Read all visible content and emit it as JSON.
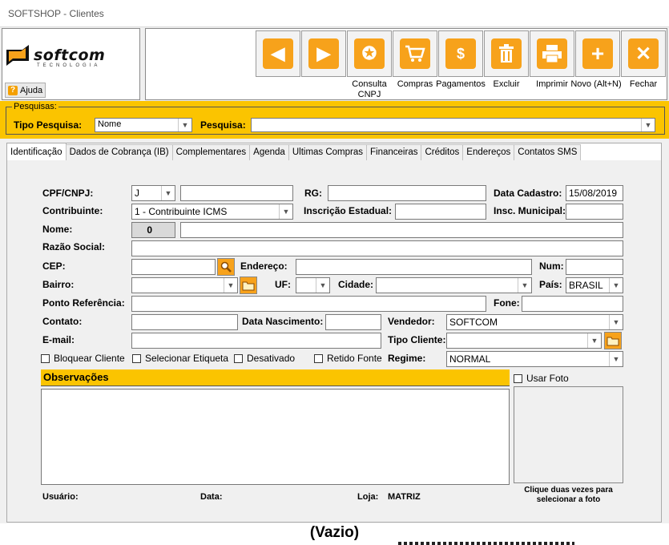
{
  "window": {
    "title": "SOFTSHOP - Clientes"
  },
  "logo": {
    "brand": "softcom",
    "tagline": "TECNOLOGIA"
  },
  "help_label": "Ajuda",
  "toolbar": {
    "nav_prev_icon": "arrow-left-icon",
    "nav_next_icon": "arrow-right-icon",
    "buttons": [
      {
        "label": "Consulta CNPJ",
        "icon": "seal-icon"
      },
      {
        "label": "Compras",
        "icon": "cart-icon"
      },
      {
        "label": "Pagamentos",
        "icon": "money-icon"
      },
      {
        "label": "Excluir",
        "icon": "trash-icon"
      },
      {
        "label": "Imprimir",
        "icon": "printer-icon"
      },
      {
        "label": "Novo (Alt+N)",
        "icon": "plus-icon"
      },
      {
        "label": "Fechar",
        "icon": "close-icon"
      }
    ],
    "accent_color": "#f7a21b"
  },
  "search": {
    "legend": "Pesquisas:",
    "type_label": "Tipo Pesquisa:",
    "type_value": "Nome",
    "query_label": "Pesquisa:",
    "query_value": ""
  },
  "tabs": [
    "Identificação",
    "Dados de Cobrança (IB)",
    "Complementares",
    "Agenda",
    "Ultimas Compras",
    "Financeiras",
    "Créditos",
    "Endereços",
    "Contatos SMS"
  ],
  "form": {
    "cpf_label": "CPF/CNPJ:",
    "cpf_type": "J",
    "cpf_value": "",
    "rg_label": "RG:",
    "rg_value": "",
    "data_cadastro_label": "Data Cadastro:",
    "data_cadastro": "15/08/2019",
    "contribuinte_label": "Contribuinte:",
    "contribuinte_value": "1 - Contribuinte ICMS",
    "ie_label": "Inscrição Estadual:",
    "ie_value": "",
    "im_label": "Insc. Municipal:",
    "im_value": "",
    "nome_label": "Nome:",
    "nome_code": "0",
    "nome_value": "",
    "razao_label": "Razão Social:",
    "razao_value": "",
    "cep_label": "CEP:",
    "cep_value": "",
    "endereco_label": "Endereço:",
    "endereco_value": "",
    "num_label": "Num:",
    "num_value": "",
    "bairro_label": "Bairro:",
    "bairro_value": "",
    "uf_label": "UF:",
    "uf_value": "",
    "cidade_label": "Cidade:",
    "cidade_value": "",
    "pais_label": "País:",
    "pais_value": "BRASIL",
    "ponto_label": "Ponto Referência:",
    "ponto_value": "",
    "fone_label": "Fone:",
    "fone_value": "",
    "contato_label": "Contato:",
    "contato_value": "",
    "nasc_label": "Data Nascimento:",
    "nasc_value": "",
    "vendedor_label": "Vendedor:",
    "vendedor_value": "SOFTCOM",
    "email_label": "E-mail:",
    "email_value": "",
    "tipo_cliente_label": "Tipo Cliente:",
    "tipo_cliente_value": "",
    "chk_bloquear": "Bloquear Cliente",
    "chk_etiqueta": "Selecionar Etiqueta",
    "chk_desativado": "Desativado",
    "chk_retido": "Retido Fonte",
    "regime_label": "Regime:",
    "regime_value": "NORMAL",
    "obs_label": "Observações",
    "usar_foto": "Usar Foto",
    "photo_hint": "Clique duas vezes para selecionar a foto",
    "usuario_label": "Usuário:",
    "data_label": "Data:",
    "loja_label": "Loja:",
    "loja_value": "MATRIZ"
  },
  "status": {
    "text": "(Vazio)"
  }
}
